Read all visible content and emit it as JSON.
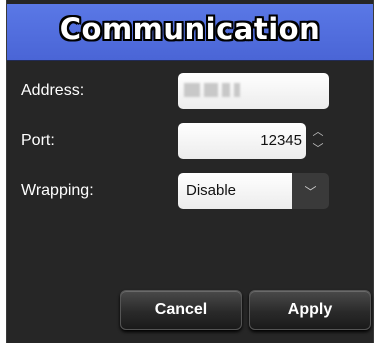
{
  "dialog": {
    "title": "Communication"
  },
  "address": {
    "label": "Address:",
    "value_masked": "■■■ ■■ ■"
  },
  "port": {
    "label": "Port:",
    "value": "12345",
    "up_icon": "chevron-up",
    "down_icon": "chevron-down"
  },
  "wrapping": {
    "label": "Wrapping:",
    "selected": "Disable",
    "arrow_icon": "chevron-down"
  },
  "buttons": {
    "cancel": "Cancel",
    "apply": "Apply"
  }
}
